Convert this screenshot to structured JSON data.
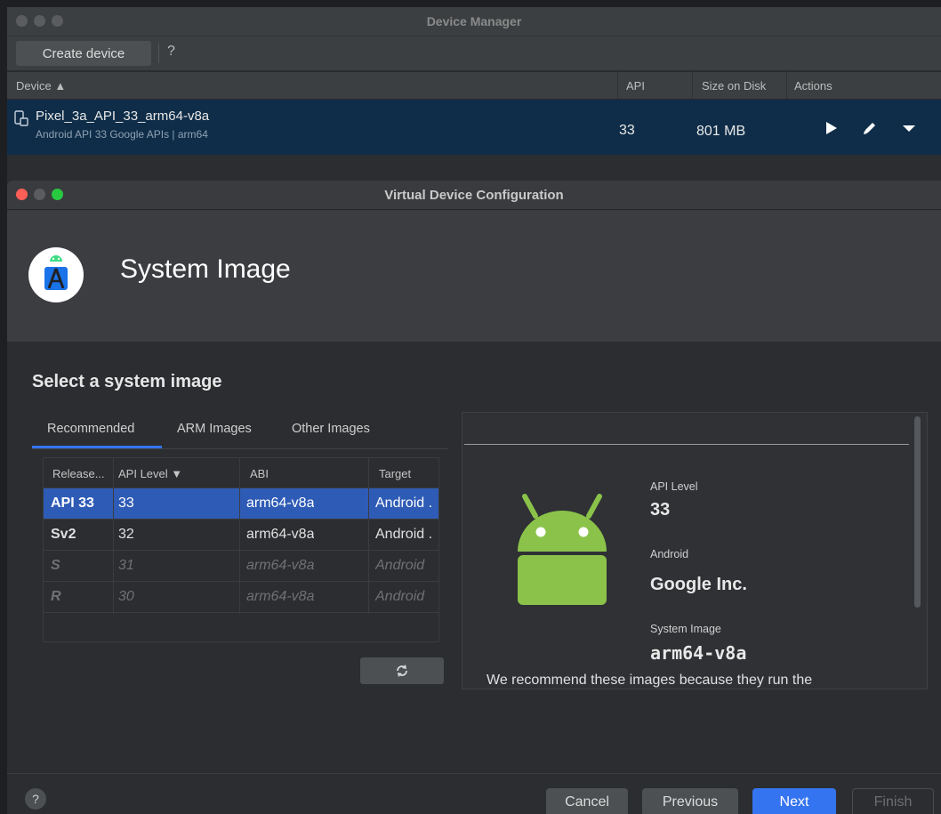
{
  "device_manager": {
    "title": "Device Manager",
    "toolbar": {
      "create_label": "Create device",
      "help_label": "?"
    },
    "columns": {
      "device": "Device ▲",
      "api": "API",
      "size": "Size on Disk",
      "actions": "Actions"
    },
    "device": {
      "name": "Pixel_3a_API_33_arm64-v8a",
      "subtitle": "Android API 33 Google APIs | arm64",
      "api": "33",
      "size": "801 MB"
    }
  },
  "vdc": {
    "title": "Virtual Device Configuration",
    "banner_title": "System Image",
    "section_title": "Select a system image",
    "tabs": [
      "Recommended",
      "ARM Images",
      "Other Images"
    ],
    "table": {
      "headers": [
        "Release...",
        "API Level ▼",
        "ABI",
        "Target"
      ],
      "rows": [
        {
          "release": "API 33",
          "api": "33",
          "abi": "arm64-v8a",
          "target": "Android ."
        },
        {
          "release": "Sv2",
          "api": "32",
          "abi": "arm64-v8a",
          "target": "Android ."
        },
        {
          "release": "S",
          "api": "31",
          "abi": "arm64-v8a",
          "target": "Android"
        },
        {
          "release": "R",
          "api": "30",
          "abi": "arm64-v8a",
          "target": "Android"
        }
      ]
    },
    "detail": {
      "api_label": "API Level",
      "api_value": "33",
      "vendor_label": "Android",
      "vendor_value": "Google Inc.",
      "image_label": "System Image",
      "image_value": "arm64-v8a",
      "note": "We recommend these images because they run the"
    },
    "footer": {
      "help": "?",
      "cancel": "Cancel",
      "previous": "Previous",
      "next": "Next",
      "finish": "Finish"
    }
  },
  "colors": {
    "selection": "#2e5bb5",
    "device_row": "#0f2d48",
    "accent": "#3574f0",
    "android_green": "#8bc34a"
  },
  "icons": [
    "device-icon",
    "run-icon",
    "edit-icon",
    "menu-dropdown-icon",
    "android-studio-logo",
    "refresh-icon",
    "android-robot-icon",
    "help-icon"
  ]
}
